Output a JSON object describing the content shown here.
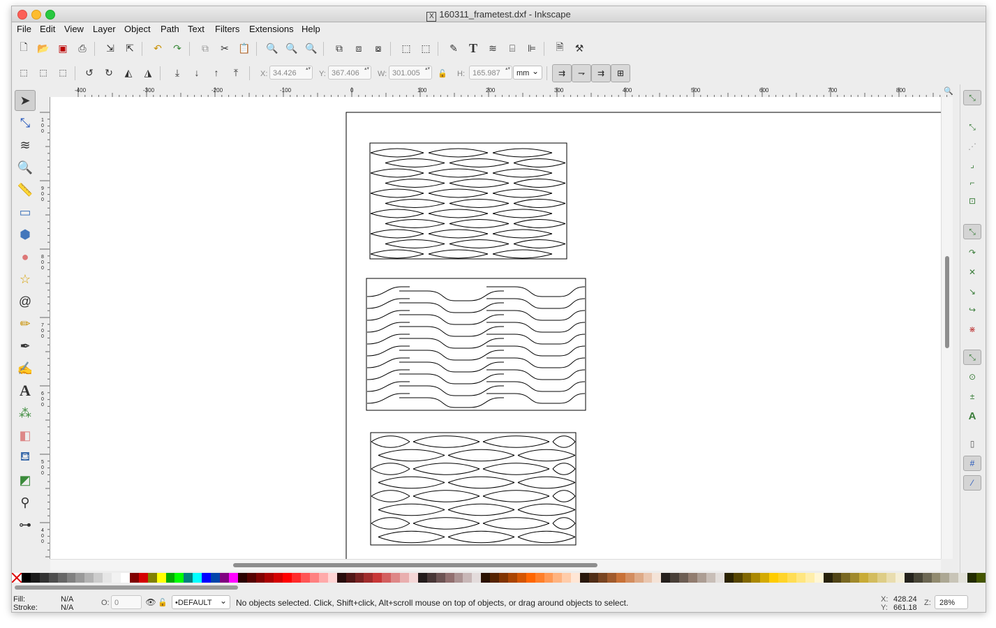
{
  "window": {
    "title": "160311_frametest.dxf - Inkscape"
  },
  "menu": [
    "File",
    "Edit",
    "View",
    "Layer",
    "Object",
    "Path",
    "Text",
    "Filters",
    "Extensions",
    "Help"
  ],
  "toolbar": {
    "icons": [
      "new-document-icon",
      "open-icon",
      "save-icon",
      "print-icon",
      "import-icon",
      "export-icon",
      "undo-icon",
      "redo-icon",
      "copy-icon",
      "cut-icon",
      "paste-icon",
      "zoom-selection-icon",
      "zoom-drawing-icon",
      "zoom-page-icon",
      "duplicate-icon",
      "clone-icon",
      "unlink-clone-icon",
      "group-icon",
      "ungroup-icon",
      "fill-stroke-icon",
      "text-font-icon",
      "layers-icon",
      "xml-editor-icon",
      "align-distribute-icon",
      "document-properties-icon",
      "preferences-icon"
    ]
  },
  "selector": {
    "x_label": "X:",
    "x_value": "34.426",
    "y_label": "Y:",
    "y_value": "367.406",
    "w_label": "W:",
    "w_value": "301.005",
    "h_label": "H:",
    "h_value": "165.987",
    "unit": "mm"
  },
  "ruler": {
    "h_labels": [
      "-400",
      "-300",
      "-200",
      "-100",
      "0",
      "100",
      "200",
      "300",
      "400",
      "500",
      "600",
      "700",
      "800"
    ],
    "v_labels": [
      "100",
      "900",
      "800",
      "700",
      "600",
      "500",
      "400"
    ]
  },
  "tools": [
    "selector-arrow-icon",
    "node-editor-icon",
    "tweak-icon",
    "zoom-icon",
    "measure-icon",
    "rectangle-icon",
    "3d-box-icon",
    "ellipse-icon",
    "star-icon",
    "spiral-icon",
    "pencil-icon",
    "pen-icon",
    "calligraphy-icon",
    "text-tool-icon",
    "spray-icon",
    "eraser-icon",
    "paint-bucket-icon",
    "gradient-icon",
    "dropper-icon",
    "connector-icon"
  ],
  "palette": [
    "#000000",
    "#1a1a1a",
    "#333333",
    "#4d4d4d",
    "#666666",
    "#808080",
    "#999999",
    "#b3b3b3",
    "#cccccc",
    "#e6e6e6",
    "#f2f2f2",
    "#ffffff",
    "#800000",
    "#d40000",
    "#808000",
    "#ffff00",
    "#00aa00",
    "#00ff00",
    "#008080",
    "#00ffff",
    "#0000ff",
    "#0044aa",
    "#800080",
    "#ff00ff",
    "#2b0000",
    "#550000",
    "#800000",
    "#aa0000",
    "#d40000",
    "#ff0000",
    "#ff2a2a",
    "#ff5555",
    "#ff8080",
    "#ffaaaa",
    "#ffd5d5",
    "#280b0b",
    "#501616",
    "#782121",
    "#a02c2c",
    "#c83737",
    "#d35f5f",
    "#de8787",
    "#e9afaf",
    "#f4d7d7",
    "#241c1c",
    "#483737",
    "#6c5353",
    "#916f6f",
    "#ac9393",
    "#c8b7b7",
    "#e3dbdb",
    "#2b1100",
    "#552200",
    "#803300",
    "#aa4400",
    "#d45500",
    "#ff6600",
    "#ff7f2a",
    "#ff9955",
    "#ffb380",
    "#ffccaa",
    "#ffe6d5",
    "#28170b",
    "#502d16",
    "#784421",
    "#a05a2c",
    "#c87137",
    "#d38d5f",
    "#deaa87",
    "#e9c6af",
    "#f4e3d7",
    "#241f1c",
    "#483e37",
    "#6c5d53",
    "#917c6f",
    "#ac9d93",
    "#c8beb7",
    "#e3dedb",
    "#2b2200",
    "#554400",
    "#806600",
    "#aa8800",
    "#d4aa00",
    "#ffcc00",
    "#ffd42a",
    "#ffdd55",
    "#ffe680",
    "#ffeeaa",
    "#fff6d5",
    "#28220b",
    "#504416",
    "#786721",
    "#a0892c",
    "#c8ab37",
    "#d3bc5f",
    "#decd87",
    "#e9ddaf",
    "#f4eed7",
    "#24221c",
    "#484537",
    "#6c6753",
    "#918a6f",
    "#aca793",
    "#c8c4b7",
    "#e3e2db",
    "#222b00",
    "#445500"
  ],
  "status": {
    "fill_label": "Fill:",
    "fill_value": "N/A",
    "stroke_label": "Stroke:",
    "stroke_value": "N/A",
    "opacity_label": "O:",
    "opacity_value": "0",
    "layer": "•DEFAULT",
    "message": "No objects selected. Click, Shift+click, Alt+scroll mouse on top of objects, or drag around objects to select.",
    "x_label": "X:",
    "x_value": "428.24",
    "y_label": "Y:",
    "y_value": "661.18",
    "z_label": "Z:",
    "zoom": "28%"
  }
}
